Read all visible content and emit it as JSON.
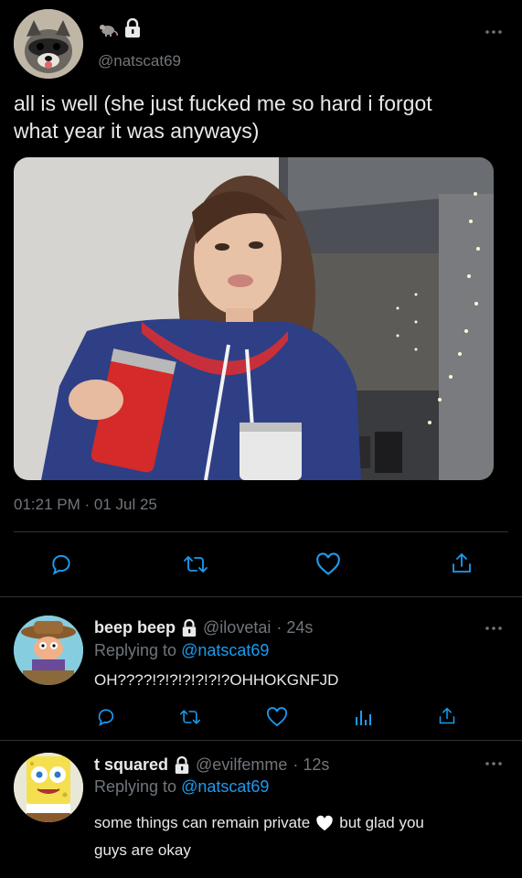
{
  "main_tweet": {
    "handle": "@natscat69",
    "text_line1": "all is well (she just fucked me so hard i forgot",
    "text_line2": "what year it was anyways)",
    "timestamp": "01:21 PM · 01 Jul 25",
    "badges": [
      "rat-emoji-icon",
      "lock-icon"
    ]
  },
  "actions": [
    "reply-icon",
    "retweet-icon",
    "like-icon",
    "share-icon"
  ],
  "replies": [
    {
      "name": "beep beep",
      "handle": "@ilovetai",
      "time": "· 24s",
      "replying_prefix": "Replying to",
      "replying_to": "@natscat69",
      "text": "OH????!?!?!?!?!?!?OHHOKGNFJD"
    },
    {
      "name": "t squared",
      "handle": "@evilfemme",
      "time": "· 12s",
      "replying_prefix": "Replying to",
      "replying_to": "@natscat69",
      "text_line1_a": "some things can remain private",
      "text_line1_b": "but glad you",
      "text_line2": "guys are okay"
    }
  ],
  "colors": {
    "background": "#000000",
    "text": "#e7e9ea",
    "muted": "#71767b",
    "link": "#1d9bf0",
    "divider": "#2f3336"
  }
}
